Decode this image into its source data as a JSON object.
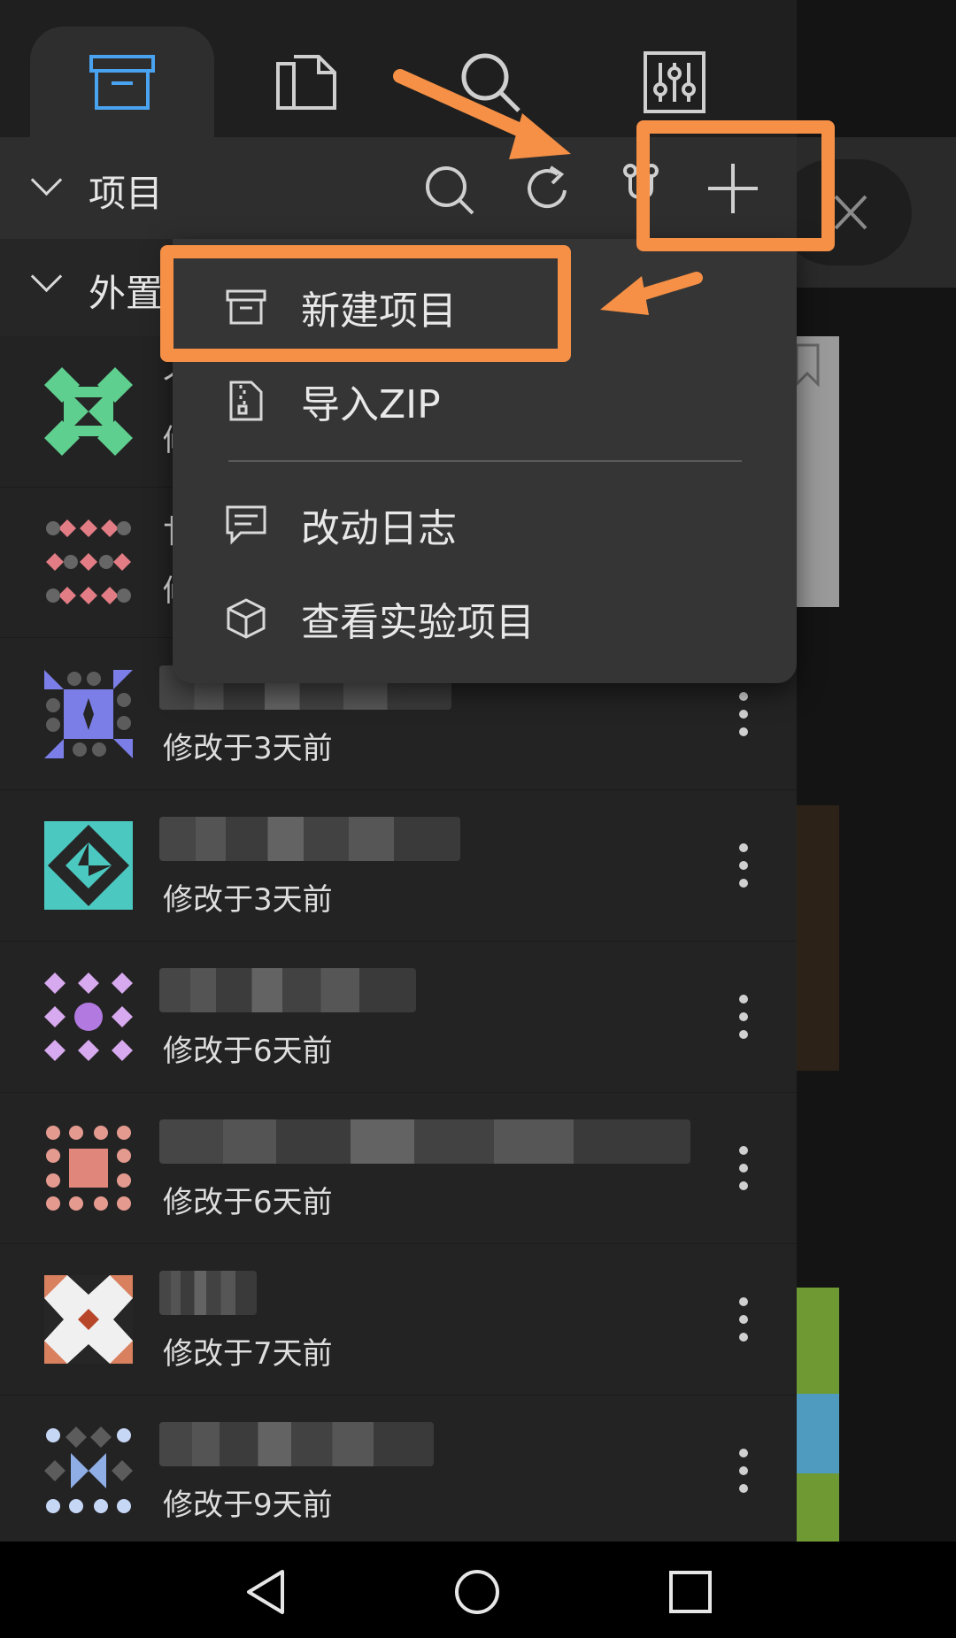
{
  "tabs": [
    {
      "name": "projects",
      "icon": "archive-box-icon",
      "active": true
    },
    {
      "name": "files",
      "icon": "files-icon",
      "active": false
    },
    {
      "name": "search",
      "icon": "search-icon",
      "active": false
    },
    {
      "name": "settings",
      "icon": "sliders-icon",
      "active": false
    }
  ],
  "project_bar": {
    "title": "项目",
    "actions": [
      "search-icon",
      "refresh-icon",
      "git-branch-icon",
      "plus-icon"
    ]
  },
  "section": {
    "title": "外置"
  },
  "menu": {
    "items": [
      {
        "label": "新建项目",
        "icon": "archive-box-icon"
      },
      {
        "label": "导入ZIP",
        "icon": "zip-file-icon"
      },
      {
        "label": "改动日志",
        "icon": "comment-icon"
      },
      {
        "label": "查看实验项目",
        "icon": "cube-icon"
      }
    ]
  },
  "projects": [
    {
      "modified": "修改于3天前",
      "avatar_color": "#7b7ee6"
    },
    {
      "modified": "修改于3天前",
      "avatar_color": "#4bc8c0"
    },
    {
      "modified": "修改于6天前",
      "avatar_color": "#b27ae0"
    },
    {
      "modified": "修改于6天前",
      "avatar_color": "#e0867a"
    },
    {
      "modified": "修改于7天前",
      "avatar_color": "#d9805f"
    },
    {
      "modified": "修改于9天前",
      "avatar_color": "#8faee6"
    }
  ],
  "partial_rows": [
    {
      "avatar_color": "#5fcf8f",
      "label_initial": "个",
      "sub_initial": "修"
    },
    {
      "avatar_color": "#e27d85",
      "label_initial": "廿",
      "sub_initial": "修"
    }
  ],
  "colors": {
    "accent": "#4aa3f0",
    "annotation": "#f59046",
    "drawer": "#232323",
    "menu": "#353535"
  }
}
